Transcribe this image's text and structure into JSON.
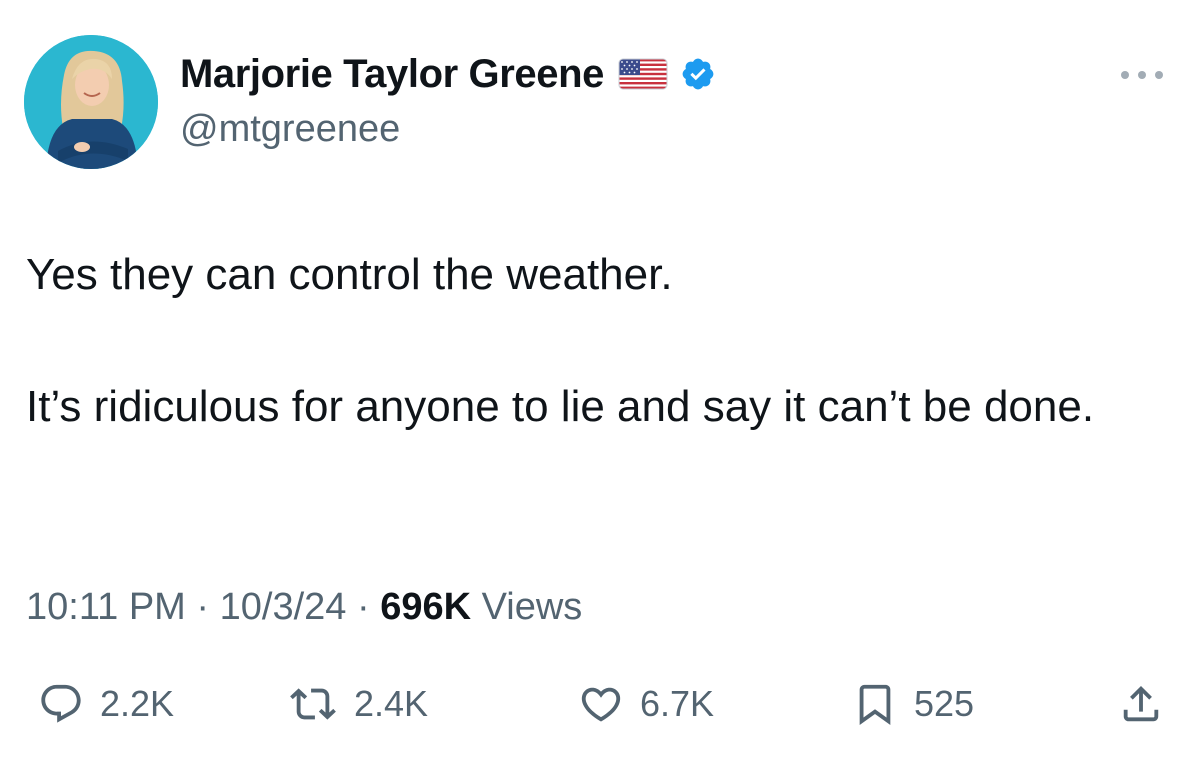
{
  "author": {
    "display_name": "Marjorie Taylor Greene",
    "handle": "@mtgreenee",
    "flag_icon": "us-flag-icon",
    "verified_icon": "verified-badge-icon",
    "verified_color": "#1d9bf0"
  },
  "tweet": {
    "paragraphs": [
      "Yes they can control the weather.",
      "It’s ridiculous for anyone to lie and say it can’t be done."
    ]
  },
  "meta": {
    "time": "10:11 PM",
    "separator": "·",
    "date": "10/3/24",
    "views_count": "696K",
    "views_label": "Views"
  },
  "actions": {
    "reply_count": "2.2K",
    "retweet_count": "2.4K",
    "like_count": "6.7K",
    "bookmark_count": "525"
  },
  "colors": {
    "text_primary": "#0f1419",
    "text_secondary": "#536471",
    "accent": "#1d9bf0"
  }
}
